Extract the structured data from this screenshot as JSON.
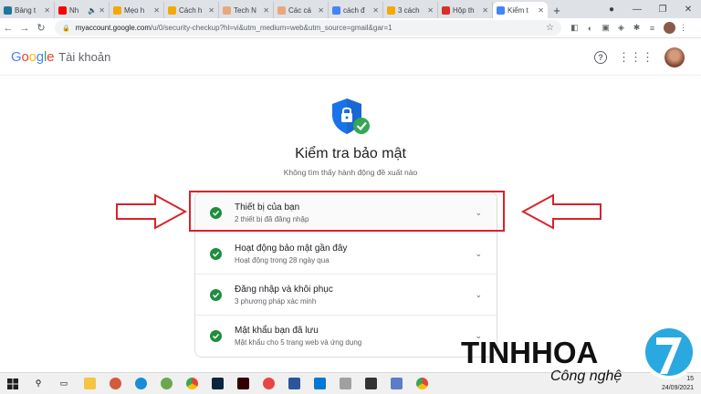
{
  "browser": {
    "tabs": [
      {
        "label": "Bảng t",
        "icon": "wordpress-icon",
        "color": "#21759b"
      },
      {
        "label": "Nh",
        "icon": "youtube-icon",
        "color": "#ff0000",
        "audio": true
      },
      {
        "label": "Mẹo h",
        "icon": "site-icon",
        "color": "#f2a900"
      },
      {
        "label": "Cách h",
        "icon": "site-icon",
        "color": "#f2a900"
      },
      {
        "label": "Tech N",
        "icon": "site-icon",
        "color": "#e8a87c"
      },
      {
        "label": "Các cá",
        "icon": "site-icon",
        "color": "#e8a87c"
      },
      {
        "label": "cách đ",
        "icon": "google-icon",
        "color": "#4285f4"
      },
      {
        "label": "3 cách",
        "icon": "site-icon",
        "color": "#f2a900"
      },
      {
        "label": "Hộp th",
        "icon": "gmail-icon",
        "color": "#d93025"
      },
      {
        "label": "Kiểm t",
        "icon": "google-icon",
        "color": "#4285f4",
        "active": true
      }
    ],
    "url_host": "myaccount.google.com",
    "url_path": "/u/0/security-checkup?hl=vi&utm_medium=web&utm_source=gmail&gar=1"
  },
  "header": {
    "logo_letters": [
      "G",
      "o",
      "o",
      "g",
      "l",
      "e"
    ],
    "logo_colors": [
      "#4285f4",
      "#ea4335",
      "#fbbc05",
      "#4285f4",
      "#34a853",
      "#ea4335"
    ],
    "account_label": "Tài khoản"
  },
  "checkup": {
    "title": "Kiểm tra bảo mật",
    "subtitle": "Không tìm thấy hành động đề xuất nào",
    "items": [
      {
        "title": "Thiết bị của bạn",
        "detail": "2 thiết bị đã đăng nhập"
      },
      {
        "title": "Hoạt động bảo mật gần đây",
        "detail": "Hoạt động trong 28 ngày qua"
      },
      {
        "title": "Đăng nhập và khôi phục",
        "detail": "3 phương pháp xác minh"
      },
      {
        "title": "Mật khẩu bạn đã lưu",
        "detail": "Mật khẩu cho 5 trang web và ứng dụng"
      }
    ]
  },
  "taskbar": {
    "time": "15",
    "date": "24/09/2021"
  },
  "watermark": {
    "word": "TINHHOA",
    "sub": "Công nghệ",
    "badge_digit": "7"
  },
  "colors": {
    "accent_red": "#d8232a",
    "check_green": "#1e8e3e",
    "shield_blue": "#1a73e8"
  }
}
